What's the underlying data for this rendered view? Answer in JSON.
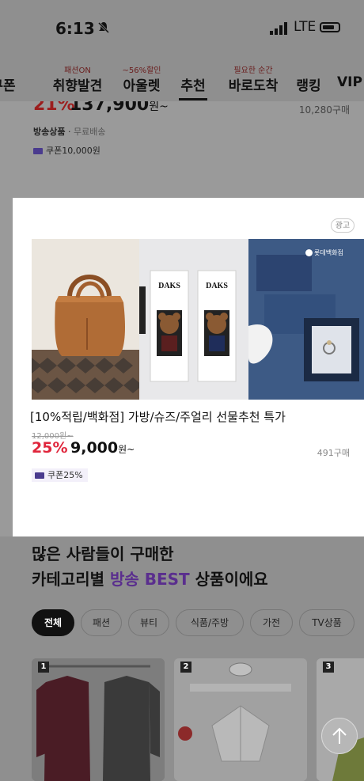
{
  "status": {
    "time": "6:13",
    "network": "LTE"
  },
  "tabs": [
    {
      "badge": "",
      "label": "쿠폰"
    },
    {
      "badge": "패션ON",
      "label": "취향발견"
    },
    {
      "badge": "~56%할인",
      "label": "아울렛"
    },
    {
      "badge": "",
      "label": "추천"
    },
    {
      "badge": "필요한 순간",
      "label": "바로도착"
    },
    {
      "badge": "",
      "label": "랭킹"
    },
    {
      "badge": "",
      "label": "VIP"
    }
  ],
  "top_product": {
    "discount": "21%",
    "price": "137,900",
    "price_suffix": "원~",
    "buy_count": "10,280구매",
    "ship_label": "방송상품",
    "ship_free": "무료배송",
    "coupon": "쿠폰10,000원"
  },
  "ad": {
    "tag": "광고",
    "brand1": "DAKS",
    "brand2": "DAKS",
    "brand_mark": "롯데백화점",
    "title": "[10%적립/백화점] 가방/슈즈/주얼리 선물추천 특가",
    "old_price": "12,000원~",
    "discount": "25%",
    "price": "9,000",
    "price_suffix": "원~",
    "buy_count": "491구매",
    "coupon": "쿠폰25%"
  },
  "best_section": {
    "title_line1": "많은 사람들이 구매한",
    "title_line2_pre": "카테고리별 ",
    "title_line2_highlight": "방송 BEST",
    "title_line2_post": " 상품이에요",
    "chips": [
      "전체",
      "패션",
      "뷰티",
      "식품/주방",
      "가전",
      "TV상품"
    ],
    "cards": [
      {
        "rank": "1"
      },
      {
        "rank": "2"
      },
      {
        "rank": "3"
      }
    ]
  },
  "icons": {
    "mute": "bell-slash-icon",
    "scroll_top": "arrow-up-icon"
  }
}
